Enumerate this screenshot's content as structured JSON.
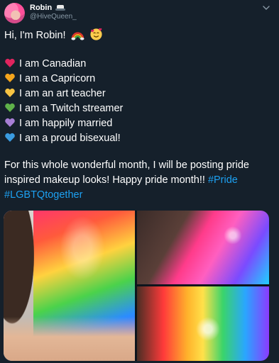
{
  "author": {
    "display_name": "Robin",
    "handle": "@HiveQueen_",
    "name_icon": "cowboy-hat-icon",
    "avatar_icon": "avatar"
  },
  "tweet": {
    "greeting": "Hi, I'm Robin!",
    "greeting_emojis": [
      "rainbow-icon",
      "smiling-face-with-hearts-icon"
    ],
    "facts": [
      {
        "heart_color": "#e0245e",
        "text": "I am Canadian"
      },
      {
        "heart_color": "#f4a41c",
        "text": "I am a Capricorn"
      },
      {
        "heart_color": "#f6c343",
        "text": "I am an art teacher"
      },
      {
        "heart_color": "#5fb14a",
        "text": "I am a Twitch streamer"
      },
      {
        "heart_color": "#a77fd6",
        "text": "I am happily married"
      },
      {
        "heart_color": "#3a9be0",
        "text": "I am a proud bisexual!"
      }
    ],
    "paragraph_line1": "For this whole wonderful month, I will be posting pride",
    "paragraph_line2_text": "inspired makeup looks! Happy pride month!! ",
    "hashtag1": "#Pride",
    "hashtag2": "#LGBTQtogether"
  },
  "colors": {
    "background": "#15202b",
    "hashtag": "#1da1f2",
    "secondary_text": "#8899a6"
  },
  "media": {
    "photo_count": 3
  }
}
